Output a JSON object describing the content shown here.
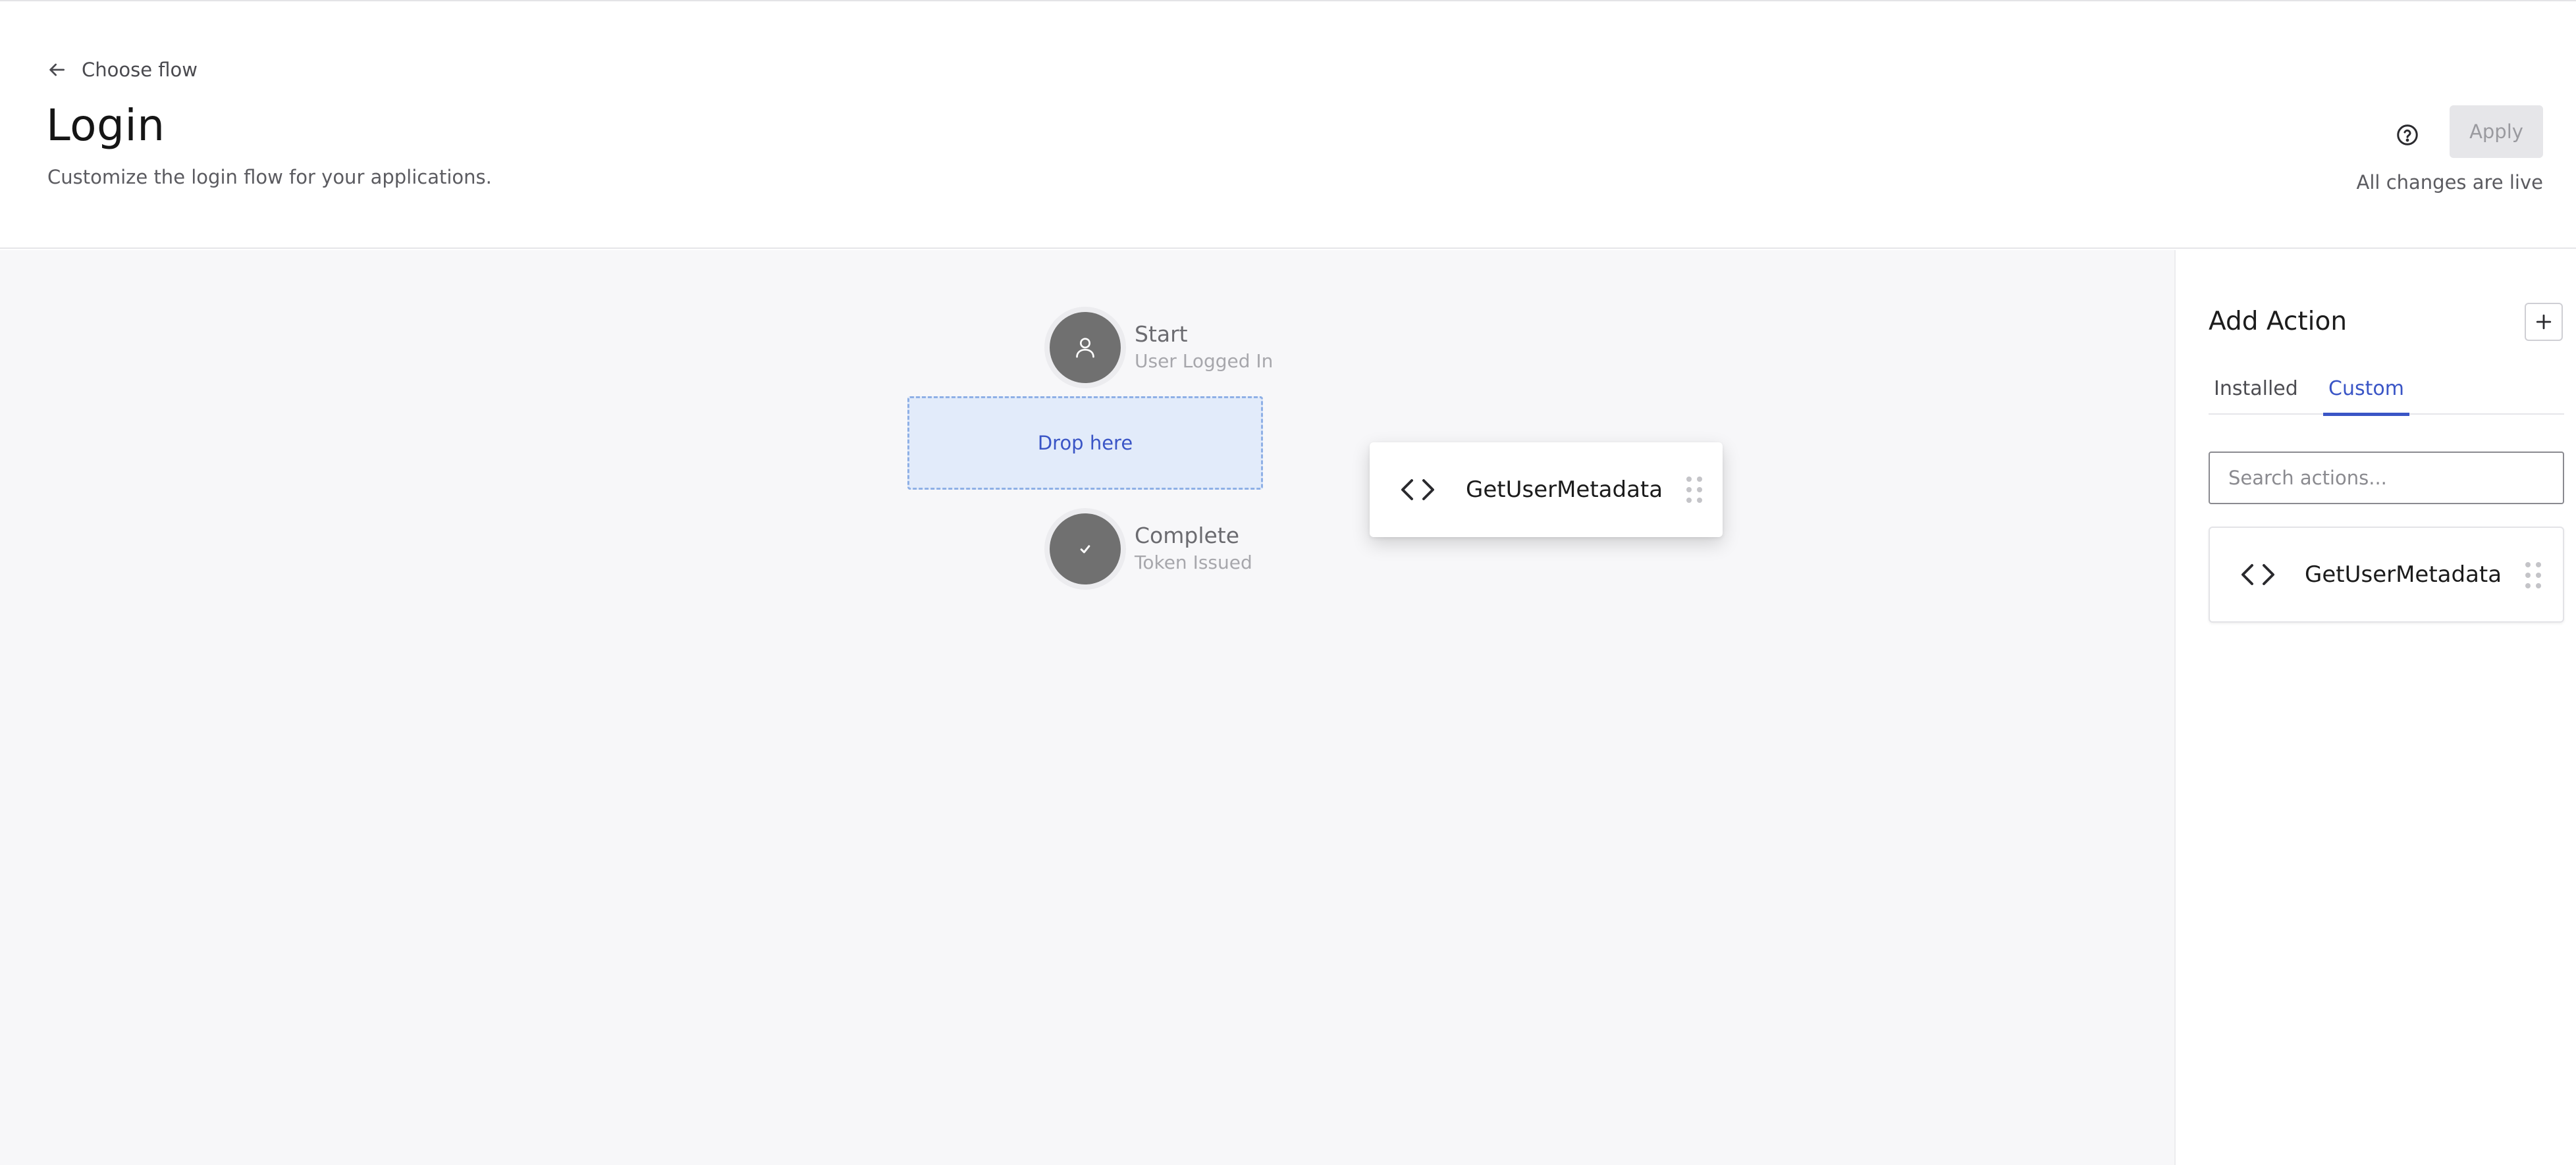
{
  "header": {
    "back_label": "Choose flow",
    "title": "Login",
    "subtitle": "Customize the login flow for your applications.",
    "apply_label": "Apply",
    "status": "All changes are live"
  },
  "flow": {
    "start": {
      "title": "Start",
      "subtitle": "User Logged In",
      "icon": "user-icon"
    },
    "drop_zone_label": "Drop here",
    "complete": {
      "title": "Complete",
      "subtitle": "Token Issued",
      "icon": "check-icon"
    },
    "dragging_action": {
      "name": "GetUserMetadata",
      "icon": "code-icon"
    }
  },
  "panel": {
    "title": "Add Action",
    "tabs": [
      {
        "label": "Installed",
        "active": false
      },
      {
        "label": "Custom",
        "active": true
      }
    ],
    "search_placeholder": "Search actions...",
    "actions": [
      {
        "name": "GetUserMetadata",
        "icon": "code-icon"
      }
    ]
  },
  "colors": {
    "accent": "#3a55c6",
    "canvas_bg": "#f7f7f9",
    "node_fill": "#707070",
    "drop_zone_bg": "#e2ebfa",
    "drop_zone_border": "#8fb0e6"
  }
}
